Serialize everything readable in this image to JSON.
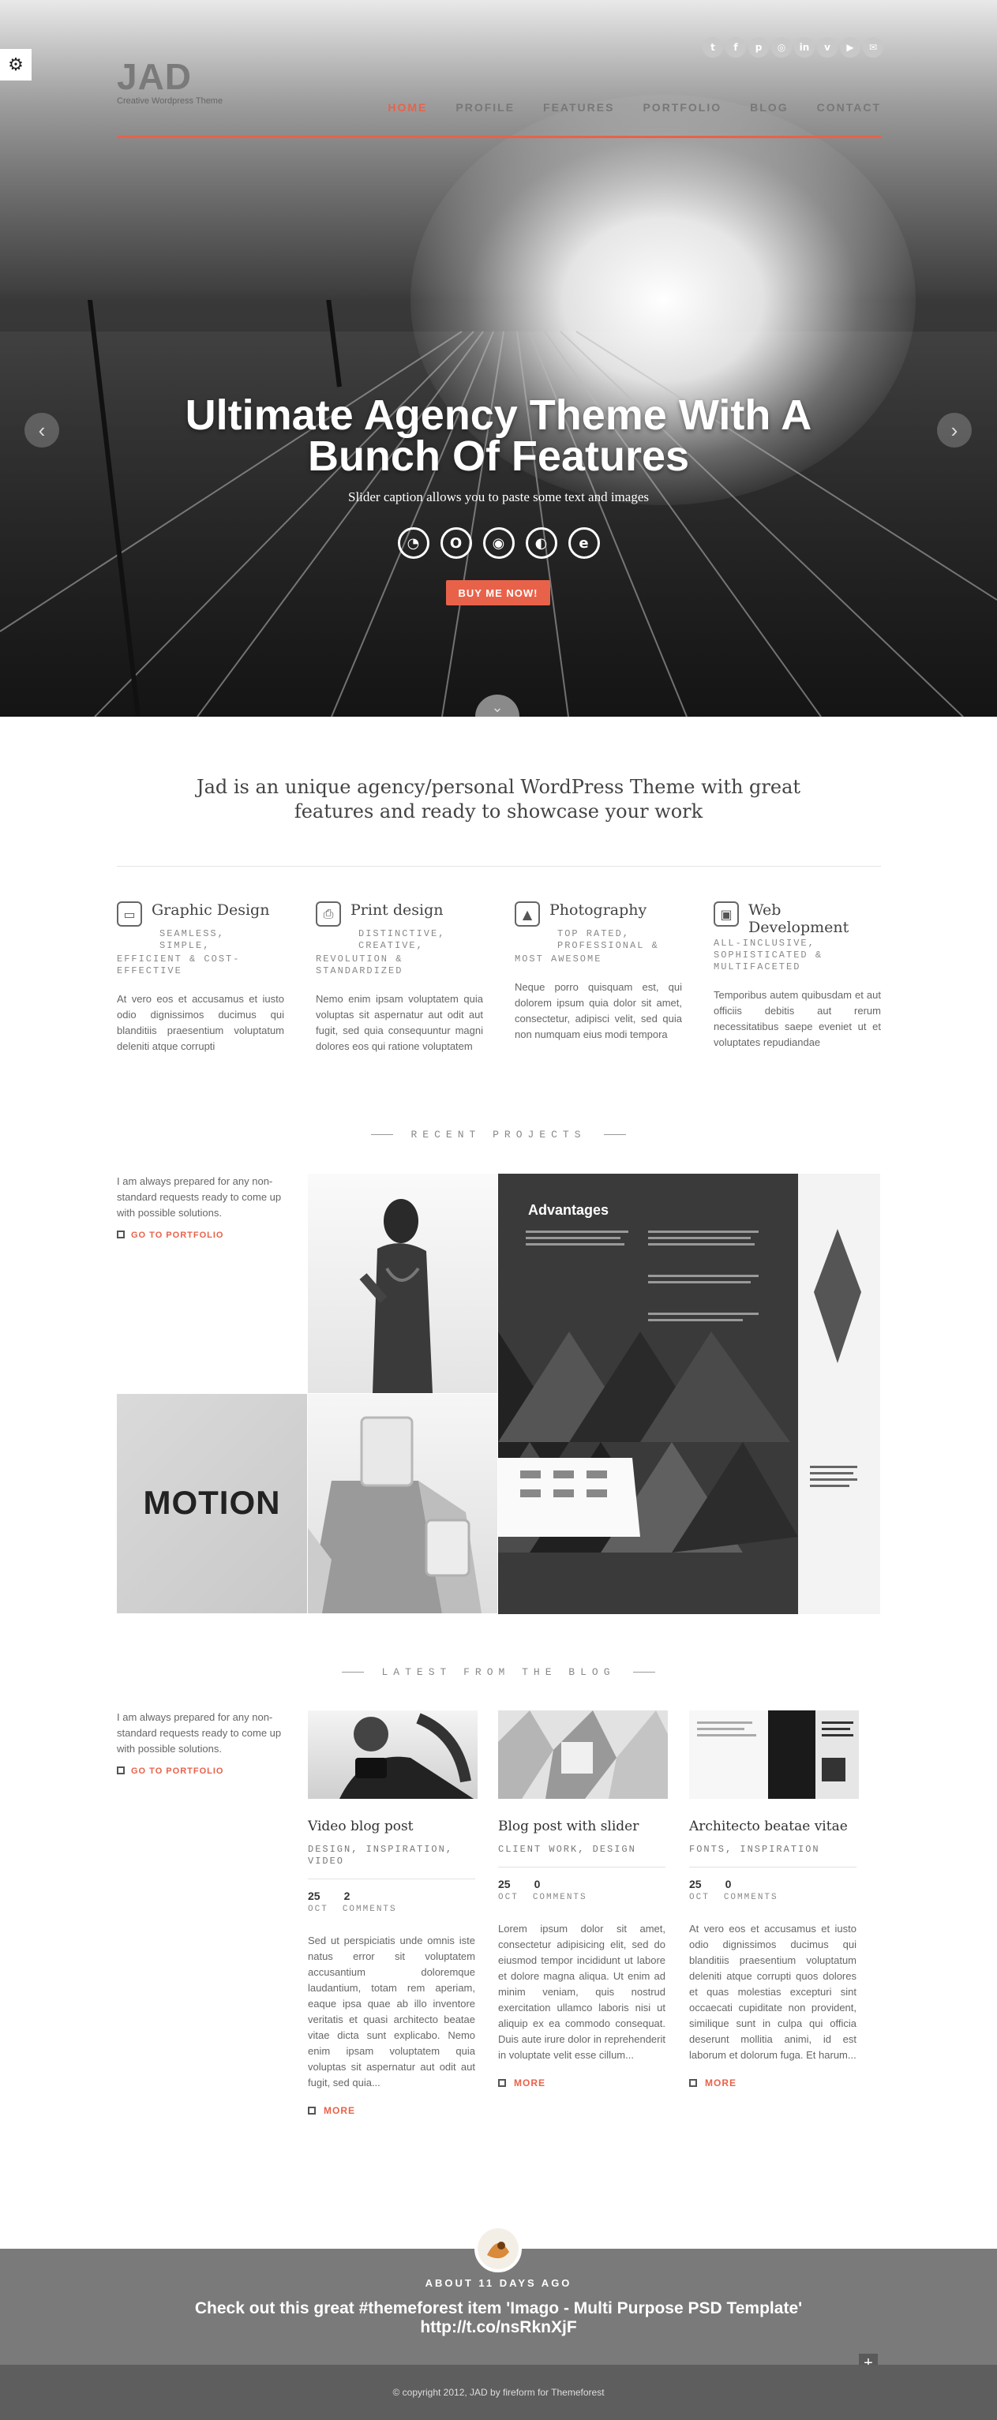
{
  "header": {
    "logo": "JAD",
    "tagline": "Creative Wordpress Theme",
    "social_icons": [
      "twitter-icon",
      "facebook-icon",
      "pinterest-icon",
      "dribbble-icon",
      "linkedin-icon",
      "vimeo-icon",
      "youtube-icon",
      "email-icon"
    ],
    "nav": [
      {
        "label": "HOME",
        "active": true
      },
      {
        "label": "PROFILE"
      },
      {
        "label": "FEATURES"
      },
      {
        "label": "PORTFOLIO"
      },
      {
        "label": "BLOG"
      },
      {
        "label": "CONTACT"
      }
    ],
    "accent_color": "#e8624a"
  },
  "hero": {
    "title_line1": "Ultimate Agency Theme With A",
    "title_line2": "Bunch Of Features",
    "caption": "Slider caption allows you to paste some text and images",
    "browser_icons": [
      "safari-icon",
      "opera-icon",
      "chrome-icon",
      "firefox-icon",
      "ie-icon"
    ],
    "button": "BUY ME NOW!"
  },
  "intro": {
    "line1": "Jad is an unique agency/personal WordPress Theme with great",
    "line2": "features and ready to showcase your work"
  },
  "features": [
    {
      "title": "Graphic Design",
      "icon": "monitor-icon",
      "kw1": "SEAMLESS,",
      "kw2": "SIMPLE,",
      "kw3": "EFFICIENT & COST-",
      "kw4": "EFFECTIVE",
      "text": "At vero eos et accusamus et iusto odio dignissimos ducimus qui blanditiis praesentium voluptatum deleniti atque corrupti"
    },
    {
      "title": "Print design",
      "icon": "printer-icon",
      "kw1": "DISTINCTIVE,",
      "kw2": "CREATIVE,",
      "kw3": "REVOLUTION &",
      "kw4": "STANDARDIZED",
      "text": "Nemo enim ipsam voluptatem quia voluptas sit aspernatur aut odit aut fugit, sed quia consequuntur magni dolores eos qui ratione voluptatem"
    },
    {
      "title": "Photography",
      "icon": "image-icon",
      "kw1": "TOP RATED,",
      "kw2": "PROFESSIONAL &",
      "kw3": "MOST AWESOME",
      "kw4": "",
      "text": "Neque porro quisquam est, qui dolorem ipsum quia dolor sit amet, consectetur, adipisci velit, sed quia non numquam eius modi tempora"
    },
    {
      "title": "Web Development",
      "icon": "briefcase-icon",
      "kw1": "ALL-INCLUSIVE,",
      "kw2": "SOPHISTICATED &",
      "kw3": "MULTIFACETED",
      "kw4": "",
      "text": "Temporibus autem quibusdam et aut officiis debitis aut rerum necessitatibus saepe eveniet ut et voluptates repudiandae"
    }
  ],
  "recent": {
    "heading": "RECENT PROJECTS",
    "side_text": "I am always prepared for any non-standard requests ready to come up with possible solutions.",
    "link": "GO TO PORTFOLIO",
    "brochure_title": "Advantages",
    "logo_text": "MOTION"
  },
  "blog": {
    "heading": "LATEST FROM THE BLOG",
    "side_text": "I am always prepared for any non-standard requests ready to come up with possible solutions.",
    "link": "GO TO PORTFOLIO",
    "posts": [
      {
        "title": "Video blog post",
        "cats": "DESIGN, INSPIRATION, VIDEO",
        "day": "25",
        "comments": "2",
        "month": "OCT",
        "comments_label": "COMMENTS",
        "text": "Sed ut perspiciatis unde omnis iste natus error sit voluptatem accusantium doloremque laudantium, totam rem aperiam, eaque ipsa quae ab illo inventore veritatis et quasi architecto beatae vitae dicta sunt explicabo. Nemo enim ipsam voluptatem quia voluptas sit aspernatur aut odit aut fugit, sed quia...",
        "more": "MORE"
      },
      {
        "title": "Blog post with slider",
        "cats": "CLIENT WORK, DESIGN",
        "day": "25",
        "comments": "0",
        "month": "OCT",
        "comments_label": "COMMENTS",
        "text": "Lorem ipsum dolor sit amet, consectetur adipisicing elit, sed do eiusmod tempor incididunt ut labore et dolore magna aliqua. Ut enim ad minim veniam, quis nostrud exercitation ullamco laboris nisi ut aliquip ex ea commodo consequat. Duis aute irure dolor in reprehenderit in voluptate velit esse cillum...",
        "more": "MORE"
      },
      {
        "title": "Architecto beatae vitae",
        "cats": "FONTS, INSPIRATION",
        "day": "25",
        "comments": "0",
        "month": "OCT",
        "comments_label": "COMMENTS",
        "text": "At vero eos et accusamus et iusto odio dignissimos ducimus qui blanditiis praesentium voluptatum deleniti atque corrupti quos dolores et quas molestias excepturi sint occaecati cupiditate non provident, similique sunt in culpa qui officia deserunt mollitia animi, id est laborum et dolorum fuga. Et harum...",
        "more": "MORE"
      }
    ]
  },
  "footer": {
    "tweet_age": "ABOUT 11 DAYS AGO",
    "tweet_line1": "Check out this great #themeforest item 'Imago - Multi Purpose PSD Template'",
    "tweet_line2": "http://t.co/nsRknXjF",
    "copyright": "© copyright 2012, JAD by fireform for Themeforest"
  }
}
